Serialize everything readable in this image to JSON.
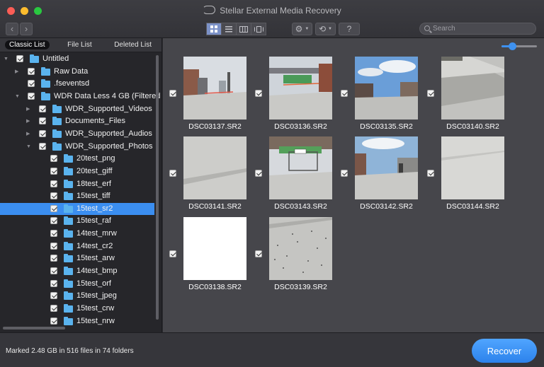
{
  "window": {
    "title": "Stellar External Media Recovery"
  },
  "toolbar": {
    "back_icon": "chevron-left-icon",
    "forward_icon": "chevron-right-icon",
    "views": [
      "grid-view-icon",
      "list-view-icon",
      "column-view-icon",
      "coverflow-view-icon"
    ],
    "active_view": 0,
    "gear_icon": "gear-icon",
    "history_icon": "history-icon",
    "help_label": "?",
    "search_placeholder": "Search",
    "zoom_level": 0.3
  },
  "tabs": [
    {
      "label": "Classic List",
      "active": true
    },
    {
      "label": "File List",
      "active": false
    },
    {
      "label": "Deleted List",
      "active": false
    }
  ],
  "tree": [
    {
      "label": "Untitled",
      "depth": 0,
      "expand": "open"
    },
    {
      "label": "Raw Data",
      "depth": 1,
      "expand": "closed"
    },
    {
      "label": ".fseventsd",
      "depth": 1,
      "expand": "none"
    },
    {
      "label": "WDR Data Less 4 GB (Filtered",
      "depth": 1,
      "expand": "open"
    },
    {
      "label": "WDR_Supported_Videos",
      "depth": 2,
      "expand": "closed"
    },
    {
      "label": "Documents_Files",
      "depth": 2,
      "expand": "closed"
    },
    {
      "label": "WDR_Supported_Audios",
      "depth": 2,
      "expand": "closed"
    },
    {
      "label": "WDR_Supported_Photos",
      "depth": 2,
      "expand": "open"
    },
    {
      "label": "20test_png",
      "depth": 3,
      "expand": "none"
    },
    {
      "label": "20test_giff",
      "depth": 3,
      "expand": "none"
    },
    {
      "label": "18test_erf",
      "depth": 3,
      "expand": "none"
    },
    {
      "label": "15test_tiff",
      "depth": 3,
      "expand": "none"
    },
    {
      "label": "15test_sr2",
      "depth": 3,
      "expand": "none",
      "selected": true
    },
    {
      "label": "15test_raf",
      "depth": 3,
      "expand": "none"
    },
    {
      "label": "14test_mrw",
      "depth": 3,
      "expand": "none"
    },
    {
      "label": "14test_cr2",
      "depth": 3,
      "expand": "none"
    },
    {
      "label": "15test_arw",
      "depth": 3,
      "expand": "none"
    },
    {
      "label": "14test_bmp",
      "depth": 3,
      "expand": "none"
    },
    {
      "label": "15test_orf",
      "depth": 3,
      "expand": "none"
    },
    {
      "label": "15test_jpeg",
      "depth": 3,
      "expand": "none"
    },
    {
      "label": "15test_crw",
      "depth": 3,
      "expand": "none"
    },
    {
      "label": "15test_nrw",
      "depth": 3,
      "expand": "none"
    }
  ],
  "files": [
    {
      "name": "DSC03137.SR2",
      "scene": "street-a"
    },
    {
      "name": "DSC03136.SR2",
      "scene": "street-b"
    },
    {
      "name": "DSC03135.SR2",
      "scene": "street-c"
    },
    {
      "name": "DSC03140.SR2",
      "scene": "wall"
    },
    {
      "name": "DSC03141.SR2",
      "scene": "concrete"
    },
    {
      "name": "DSC03143.SR2",
      "scene": "sign"
    },
    {
      "name": "DSC03142.SR2",
      "scene": "street-d"
    },
    {
      "name": "DSC03144.SR2",
      "scene": "concrete-light"
    },
    {
      "name": "DSC03138.SR2",
      "scene": "blank"
    },
    {
      "name": "DSC03139.SR2",
      "scene": "concrete-dots"
    }
  ],
  "status": {
    "text": "Marked 2.48 GB in 516 files in 74 folders"
  },
  "recover_label": "Recover",
  "colors": {
    "accent": "#3b8ef0",
    "folder": "#5ab3ee"
  }
}
